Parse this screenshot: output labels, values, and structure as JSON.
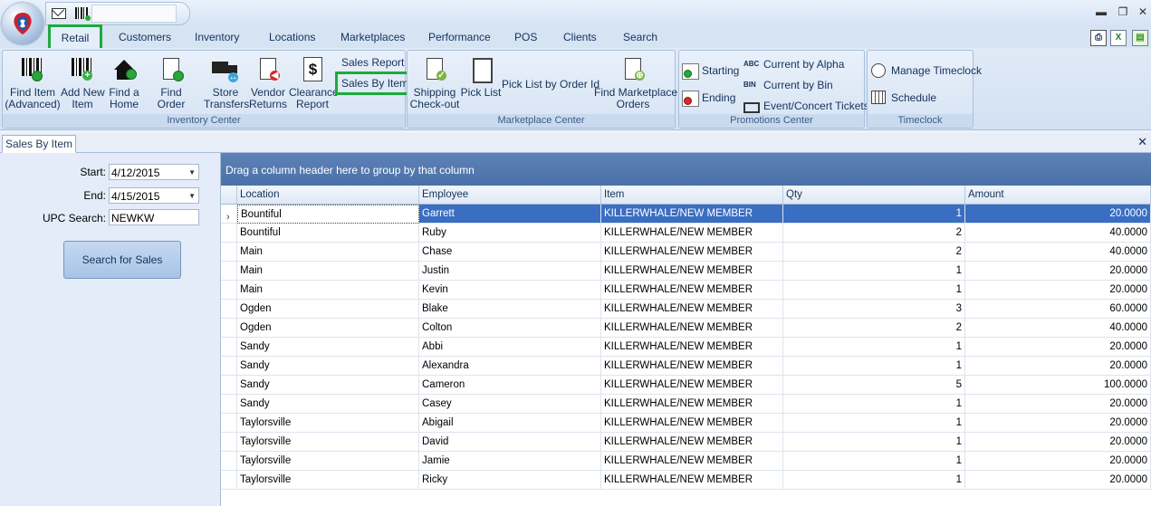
{
  "window": {
    "minimize": "▬",
    "restore": "❐",
    "close": "✕"
  },
  "tabs": [
    "Retail",
    "Customers",
    "Inventory",
    "Locations",
    "Marketplaces",
    "Performance",
    "POS",
    "Clients",
    "Search"
  ],
  "ribbon": {
    "inventory_center": {
      "label": "Inventory Center",
      "find_item": "Find Item\n(Advanced)",
      "add_new_item": "Add New\nItem",
      "find_home": "Find a\nHome",
      "find_order": "Find Order",
      "store_transfers": "Store\nTransfers",
      "vendor_returns": "Vendor\nReturns",
      "clearance_report": "Clearance\nReport",
      "sales_report": "Sales Report",
      "sales_by_item": "Sales By Item"
    },
    "marketplace_center": {
      "label": "Marketplace Center",
      "shipping_checkout": "Shipping\nCheck-out",
      "pick_list": "Pick List",
      "pick_list_by_order": "Pick List by Order Id",
      "find_marketplace_orders": "Find Marketplace\nOrders"
    },
    "promotions_center": {
      "label": "Promotions Center",
      "starting": "Starting",
      "ending": "Ending",
      "current_by_alpha": "Current by Alpha",
      "current_by_bin": "Current by Bin",
      "event_tickets": "Event/Concert Tickets"
    },
    "timeclock": {
      "label": "Timeclock",
      "manage_timeclock": "Manage Timeclock",
      "schedule": "Schedule"
    }
  },
  "doc_tab": "Sales By Item",
  "filters": {
    "start_label": "Start:",
    "start_value": "4/12/2015",
    "end_label": "End:",
    "end_value": "4/15/2015",
    "upc_label": "UPC Search:",
    "upc_value": "NEWKW",
    "search_button": "Search for Sales"
  },
  "grid": {
    "group_prompt": "Drag a column header here to group by that column",
    "columns": [
      "Location",
      "Employee",
      "Item",
      "Qty",
      "Amount"
    ],
    "rows": [
      [
        "Bountiful",
        "Garrett",
        "KILLERWHALE/NEW MEMBER",
        "1",
        "20.0000"
      ],
      [
        "Bountiful",
        "Ruby",
        "KILLERWHALE/NEW MEMBER",
        "2",
        "40.0000"
      ],
      [
        "Main",
        "Chase",
        "KILLERWHALE/NEW MEMBER",
        "2",
        "40.0000"
      ],
      [
        "Main",
        "Justin",
        "KILLERWHALE/NEW MEMBER",
        "1",
        "20.0000"
      ],
      [
        "Main",
        "Kevin",
        "KILLERWHALE/NEW MEMBER",
        "1",
        "20.0000"
      ],
      [
        "Ogden",
        "Blake",
        "KILLERWHALE/NEW MEMBER",
        "3",
        "60.0000"
      ],
      [
        "Ogden",
        "Colton",
        "KILLERWHALE/NEW MEMBER",
        "2",
        "40.0000"
      ],
      [
        "Sandy",
        "Abbi",
        "KILLERWHALE/NEW MEMBER",
        "1",
        "20.0000"
      ],
      [
        "Sandy",
        "Alexandra",
        "KILLERWHALE/NEW MEMBER",
        "1",
        "20.0000"
      ],
      [
        "Sandy",
        "Cameron",
        "KILLERWHALE/NEW MEMBER",
        "5",
        "100.0000"
      ],
      [
        "Sandy",
        "Casey",
        "KILLERWHALE/NEW MEMBER",
        "1",
        "20.0000"
      ],
      [
        "Taylorsville",
        "Abigail",
        "KILLERWHALE/NEW MEMBER",
        "1",
        "20.0000"
      ],
      [
        "Taylorsville",
        "David",
        "KILLERWHALE/NEW MEMBER",
        "1",
        "20.0000"
      ],
      [
        "Taylorsville",
        "Jamie",
        "KILLERWHALE/NEW MEMBER",
        "1",
        "20.0000"
      ],
      [
        "Taylorsville",
        "Ricky",
        "KILLERWHALE/NEW MEMBER",
        "1",
        "20.0000"
      ]
    ]
  }
}
